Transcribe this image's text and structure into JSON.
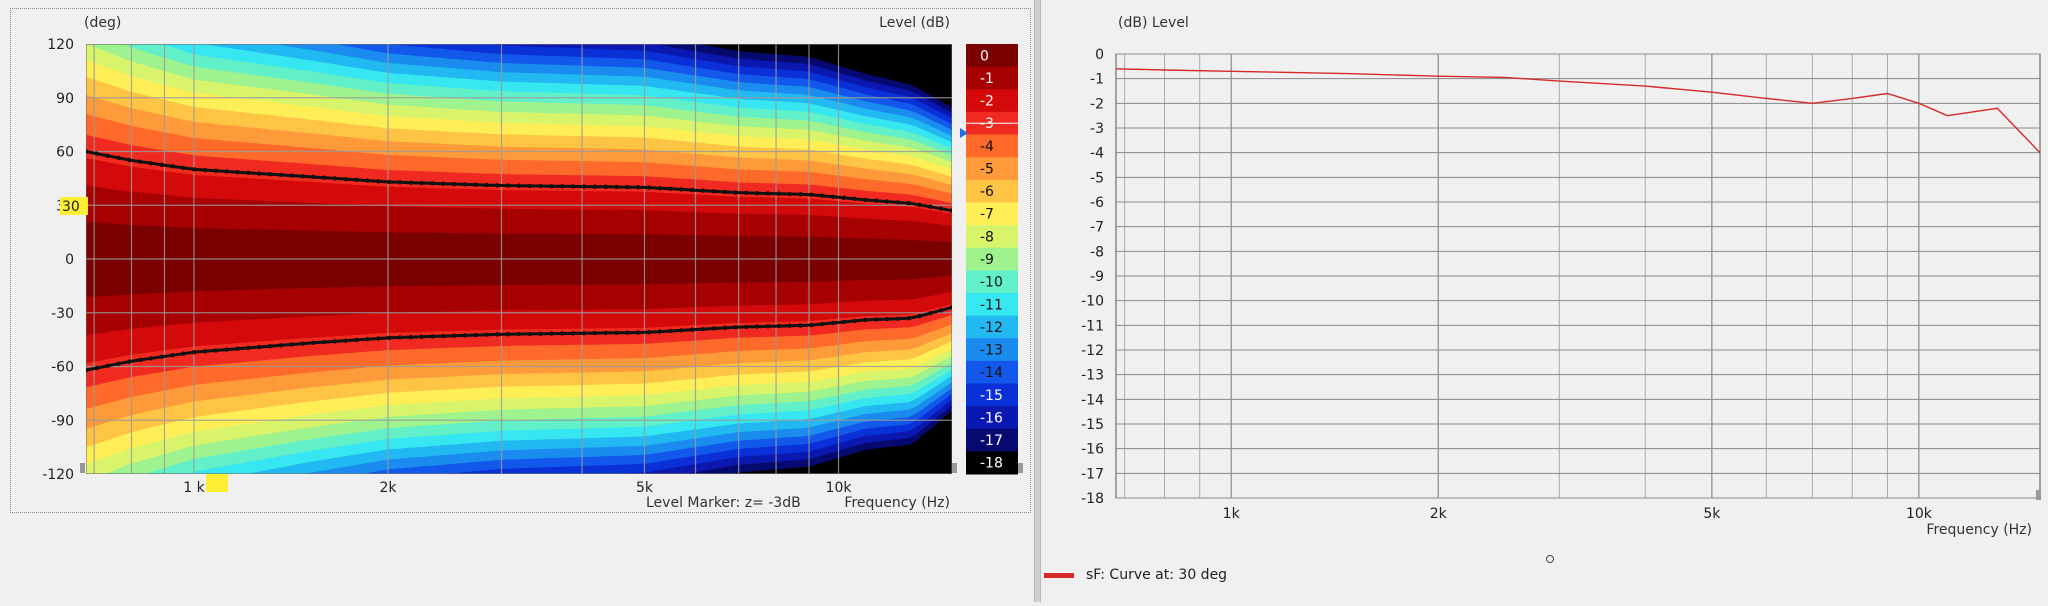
{
  "chart_data": [
    {
      "type": "heatmap",
      "y_unit_label": "(deg)",
      "level_label": "Level  (dB)",
      "xlabel": "Frequency  (Hz)",
      "marker_text": "Level Marker:  z= -3dB",
      "yticks": [
        "120",
        "90",
        "60",
        "30",
        "0",
        "-30",
        "-60",
        "-90",
        "-120"
      ],
      "xticks": [
        "1 k",
        "2k",
        "5k",
        "10k"
      ],
      "ylim": [
        -120,
        120
      ],
      "xlim_hz": [
        680,
        15000
      ],
      "colorbar_levels": [
        "0",
        "-1",
        "-2",
        "-3",
        "-4",
        "-5",
        "-6",
        "-7",
        "-8",
        "-9",
        "-10",
        "-11",
        "-12",
        "-13",
        "-14",
        "-15",
        "-16",
        "-17",
        "-18"
      ],
      "colorbar_colors": [
        "#7a0000",
        "#a60000",
        "#d40a0a",
        "#f02a20",
        "#ff6a2a",
        "#ff9a3a",
        "#ffc444",
        "#ffee55",
        "#d8f46a",
        "#9ef38e",
        "#62f0c8",
        "#36e6f0",
        "#22b8f2",
        "#1a8cf0",
        "#1258ea",
        "#0a30d8",
        "#0a18b0",
        "#060a70",
        "#000000"
      ],
      "marker_label": "30",
      "contour_3db_upper": [
        [
          680,
          60
        ],
        [
          800,
          55
        ],
        [
          1000,
          50
        ],
        [
          1500,
          46
        ],
        [
          2000,
          43
        ],
        [
          3000,
          41
        ],
        [
          5000,
          40
        ],
        [
          7000,
          37
        ],
        [
          9000,
          36
        ],
        [
          11000,
          33
        ],
        [
          13000,
          31
        ],
        [
          15000,
          27
        ]
      ],
      "contour_3db_lower": [
        [
          680,
          -62
        ],
        [
          800,
          -57
        ],
        [
          1000,
          -52
        ],
        [
          1500,
          -47
        ],
        [
          2000,
          -44
        ],
        [
          3000,
          -42
        ],
        [
          5000,
          -41
        ],
        [
          7000,
          -38
        ],
        [
          9000,
          -37
        ],
        [
          11000,
          -34
        ],
        [
          13000,
          -33
        ],
        [
          15000,
          -27
        ]
      ]
    },
    {
      "type": "line",
      "ylabel": "(dB)  Level",
      "xlabel": "Frequency  (Hz)",
      "ylim": [
        -18,
        0
      ],
      "xlim_hz": [
        680,
        15000
      ],
      "yticks": [
        "0",
        "-1",
        "-2",
        "-3",
        "-4",
        "-5",
        "-6",
        "-7",
        "-8",
        "-9",
        "-10",
        "-11",
        "-12",
        "-13",
        "-14",
        "-15",
        "-16",
        "-17",
        "-18"
      ],
      "xticks": [
        "1k",
        "2k",
        "5k",
        "10k"
      ],
      "series": [
        {
          "name": "sF: Curve at: 30 deg",
          "color": "#d62a2a",
          "x": [
            680,
            800,
            1000,
            1500,
            2000,
            2500,
            3000,
            4000,
            5000,
            6000,
            7000,
            8000,
            9000,
            10000,
            11000,
            13000,
            15000
          ],
          "y": [
            -0.6,
            -0.65,
            -0.7,
            -0.8,
            -0.9,
            -0.95,
            -1.1,
            -1.3,
            -1.55,
            -1.8,
            -2.0,
            -1.8,
            -1.6,
            -2.0,
            -2.5,
            -2.2,
            -4.0
          ]
        }
      ],
      "legend_text": "sF: Curve at: 30 deg"
    }
  ]
}
